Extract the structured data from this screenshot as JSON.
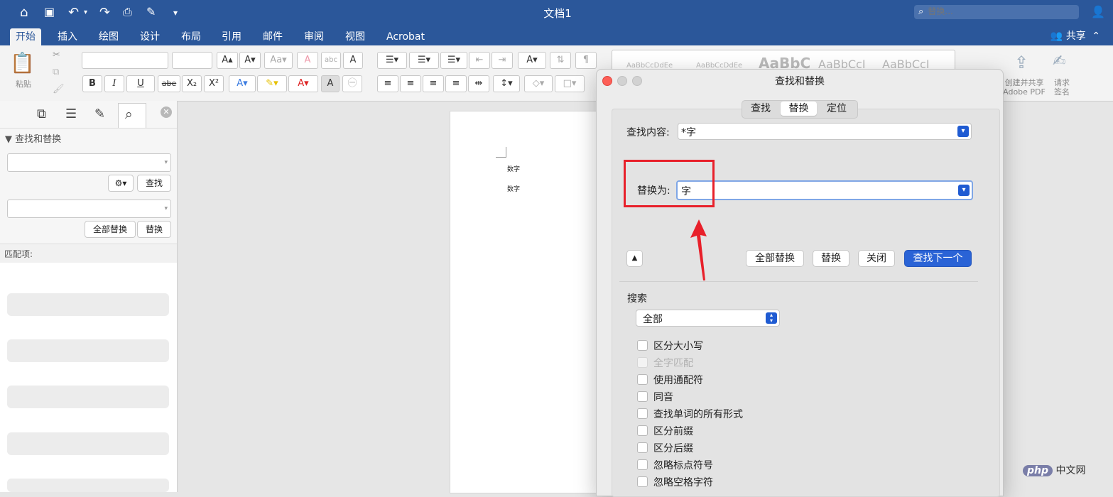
{
  "window": {
    "title": "文档1"
  },
  "search": {
    "placeholder": "替换..."
  },
  "ribbon_tabs": [
    "开始",
    "插入",
    "绘图",
    "设计",
    "布局",
    "引用",
    "邮件",
    "审阅",
    "视图",
    "Acrobat"
  ],
  "share_label": "共享",
  "toolbar": {
    "paste_label": "粘贴",
    "bold": "B",
    "italic": "I",
    "underline": "U",
    "strike": "abe",
    "subscript": "X₂",
    "superscript": "X²",
    "styles": [
      "AaBbCcDdEe",
      "AaBbCcDdEe",
      "AaBbC",
      "AaBbCcI",
      "AaBbCcI"
    ],
    "create_share_pdf": "创建并共享 Adobe PDF",
    "request_sign": "请求 签名"
  },
  "nav_pane": {
    "section_title": "▼ 查找和替换",
    "find_button": "查找",
    "replace_all_button": "全部替换",
    "replace_button": "替换",
    "matches_label": "匹配项:"
  },
  "document": {
    "lines": [
      "数字",
      "数字"
    ]
  },
  "dialog": {
    "title": "查找和替换",
    "tabs": [
      {
        "label": "查找",
        "active": false
      },
      {
        "label": "替换",
        "active": true
      },
      {
        "label": "定位",
        "active": false
      }
    ],
    "find_label": "查找内容:",
    "find_value": "*字",
    "replace_label": "替换为:",
    "replace_value": "字",
    "buttons": {
      "replace_all": "全部替换",
      "replace": "替换",
      "close": "关闭",
      "find_next": "查找下一个"
    },
    "search_section_label": "搜索",
    "search_scope": "全部",
    "options": [
      {
        "label": "区分大小写",
        "checked": false,
        "enabled": true
      },
      {
        "label": "全字匹配",
        "checked": false,
        "enabled": false
      },
      {
        "label": "使用通配符",
        "checked": false,
        "enabled": true
      },
      {
        "label": "同音",
        "checked": false,
        "enabled": true
      },
      {
        "label": "查找单词的所有形式",
        "checked": false,
        "enabled": true
      },
      {
        "label": "区分前缀",
        "checked": false,
        "enabled": true
      },
      {
        "label": "区分后缀",
        "checked": false,
        "enabled": true
      },
      {
        "label": "忽略标点符号",
        "checked": false,
        "enabled": true
      },
      {
        "label": "忽略空格字符",
        "checked": false,
        "enabled": true
      }
    ]
  },
  "watermark": {
    "text": "php 中文网"
  },
  "colors": {
    "accent": "#2b579a",
    "annotation": "#e8202a",
    "primary_button": "#2a63d6"
  }
}
